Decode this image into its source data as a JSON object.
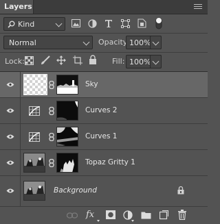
{
  "panel": {
    "tab_title": "Layers"
  },
  "filter": {
    "kind_label": "Kind"
  },
  "blend": {
    "mode": "Normal",
    "opacity_label": "Opacity:",
    "opacity_value": "100%"
  },
  "lock": {
    "label": "Lock:",
    "fill_label": "Fill:",
    "fill_value": "100%"
  },
  "layers": [
    {
      "name": "Sky"
    },
    {
      "name": "Curves 2"
    },
    {
      "name": "Curves 1"
    },
    {
      "name": "Topaz Gritty 1"
    },
    {
      "name": "Background"
    }
  ],
  "footer": {
    "fx_label": "fx"
  }
}
